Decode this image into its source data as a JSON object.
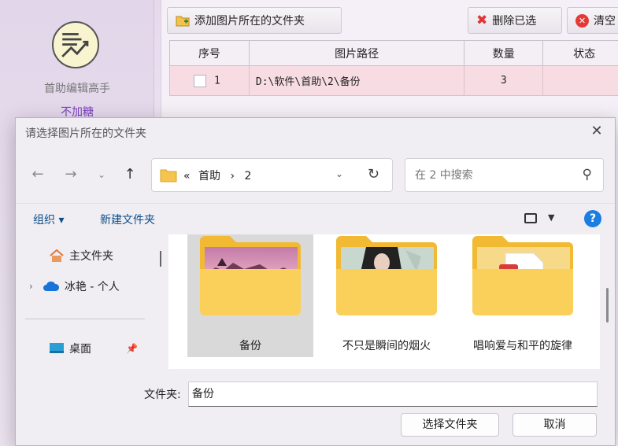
{
  "app": {
    "name": "首助编辑高手",
    "subtitle": "不加糖",
    "toolbar": {
      "add_folder": "添加图片所在的文件夹",
      "delete_selected": "删除已选",
      "clear": "清空"
    },
    "table": {
      "columns": [
        "序号",
        "图片路径",
        "数量",
        "状态"
      ],
      "rows": [
        {
          "index": "1",
          "path": "D:\\软件\\首助\\2\\备份",
          "count": "3",
          "status": ""
        }
      ]
    }
  },
  "dialog": {
    "title": "请选择图片所在的文件夹",
    "address": {
      "prefix": "«",
      "crumb1": "首助",
      "separator": "›",
      "crumb2": "2"
    },
    "search": {
      "placeholder": "在 2 中搜索"
    },
    "commands": {
      "organize": "组织 ▾",
      "new_folder": "新建文件夹"
    },
    "nav": {
      "home": "主文件夹",
      "cloud": "冰艳 - 个人",
      "desktop": "桌面"
    },
    "items": [
      {
        "label": "备份"
      },
      {
        "label": "不只是瞬间的烟火"
      },
      {
        "label": "唱响爱与和平的旋律"
      }
    ],
    "folder_field": {
      "label": "文件夹:",
      "value": "备份"
    },
    "buttons": {
      "ok": "选择文件夹",
      "cancel": "取消"
    }
  }
}
